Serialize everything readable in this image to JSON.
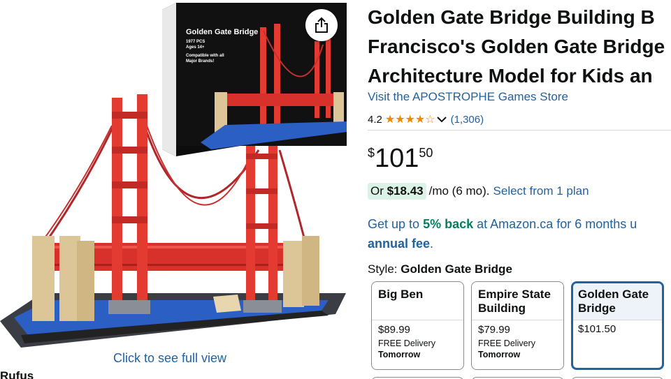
{
  "gallery": {
    "box_title": "Golden Gate Bridge",
    "box_pieces": "1977 PCS",
    "box_ages": "Ages 14+",
    "box_compat": "Compatible with all Major Brands!",
    "full_view_link": "Click to see full view",
    "rufus_label": "Rufus",
    "share_icon": "share-icon"
  },
  "product": {
    "title_lines": [
      "Golden Gate Bridge Building B",
      "Francisco's Golden Gate Bridge",
      "Architecture Model for Kids an"
    ],
    "store_link": "Visit the APOSTROPHE Games Store",
    "rating": "4.2",
    "stars_value": 4.2,
    "stars_display": "★★★★☆",
    "rating_count": "(1,306)",
    "colors": {
      "link": "#2162a1",
      "star": "#f08804",
      "green": "#067d62",
      "selected_border": "#2162a1"
    }
  },
  "price": {
    "symbol": "$",
    "whole": "101",
    "fraction": "50"
  },
  "monthly": {
    "prefix": "Or",
    "amount": "$18.43",
    "term": "/mo (6 mo).",
    "plan_link": "Select from 1 plan"
  },
  "cashback": {
    "text1": "Get up to",
    "percent": "5% back",
    "text2": "at Amazon.ca for 6 months u",
    "bold_text": "annual fee",
    "end": "."
  },
  "style": {
    "label": "Style:",
    "selected_value": "Golden Gate Bridge",
    "options": [
      {
        "name": "Big Ben",
        "price": "$89.99",
        "delivery_line1": "FREE Delivery",
        "delivery_line2": "Tomorrow"
      },
      {
        "name": "Empire State Building",
        "price": "$79.99",
        "delivery_line1": "FREE Delivery",
        "delivery_line2": "Tomorrow"
      },
      {
        "name": "Golden Gate Bridge",
        "price": "$101.50"
      }
    ]
  }
}
